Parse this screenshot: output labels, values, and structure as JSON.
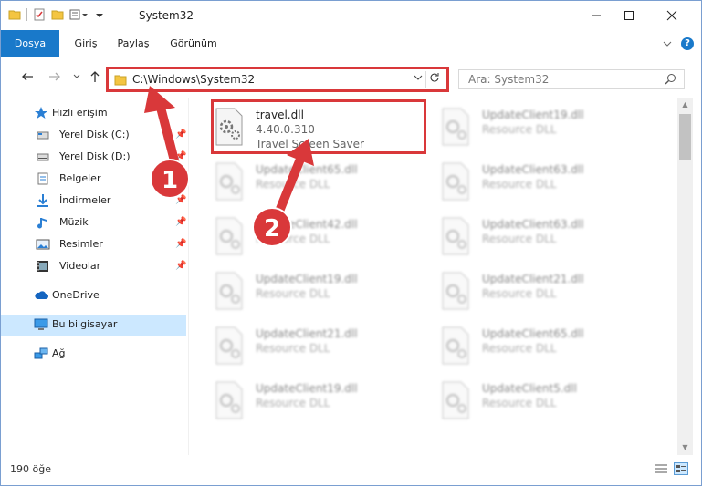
{
  "window": {
    "title": "System32"
  },
  "ribbon": {
    "tabs": [
      "Dosya",
      "Giriş",
      "Paylaş",
      "Görünüm"
    ]
  },
  "address": {
    "path": "C:\\Windows\\System32"
  },
  "search": {
    "placeholder": "Ara: System32"
  },
  "sidebar": {
    "quick_access": "Hızlı erişim",
    "items": [
      {
        "label": "Yerel Disk (C:)",
        "icon": "drive-icon"
      },
      {
        "label": "Yerel Disk (D:)",
        "icon": "drive-icon"
      },
      {
        "label": "Belgeler",
        "icon": "documents-icon"
      },
      {
        "label": "İndirmeler",
        "icon": "downloads-icon"
      },
      {
        "label": "Müzik",
        "icon": "music-icon"
      },
      {
        "label": "Resimler",
        "icon": "pictures-icon"
      },
      {
        "label": "Videolar",
        "icon": "videos-icon"
      }
    ],
    "onedrive": "OneDrive",
    "this_pc": "Bu bilgisayar",
    "network": "Ağ"
  },
  "files": {
    "featured": {
      "name": "travel.dll",
      "version": "4.40.0.310",
      "description": "Travel Screen Saver"
    },
    "others": [
      {
        "name": "UpdateClient19.dll",
        "type": "Resource DLL"
      },
      {
        "name": "UpdateClient65.dll",
        "type": "Resource DLL"
      },
      {
        "name": "UpdateClient63.dll",
        "type": "Resource DLL"
      },
      {
        "name": "UpdateClient42.dll",
        "type": "Resource DLL"
      },
      {
        "name": "UpdateClient63.dll",
        "type": "Resource DLL"
      },
      {
        "name": "UpdateClient19.dll",
        "type": "Resource DLL"
      },
      {
        "name": "UpdateClient21.dll",
        "type": "Resource DLL"
      },
      {
        "name": "UpdateClient21.dll",
        "type": "Resource DLL"
      },
      {
        "name": "UpdateClient65.dll",
        "type": "Resource DLL"
      },
      {
        "name": "UpdateClient19.dll",
        "type": "Resource DLL"
      },
      {
        "name": "UpdateClient5.dll",
        "type": "Resource DLL"
      }
    ]
  },
  "status": {
    "count": "190 öğe"
  },
  "annotations": {
    "step1": "1",
    "step2": "2"
  },
  "colors": {
    "accent": "#1979ca",
    "annotation": "#d9383a",
    "selection": "#cce8ff"
  }
}
